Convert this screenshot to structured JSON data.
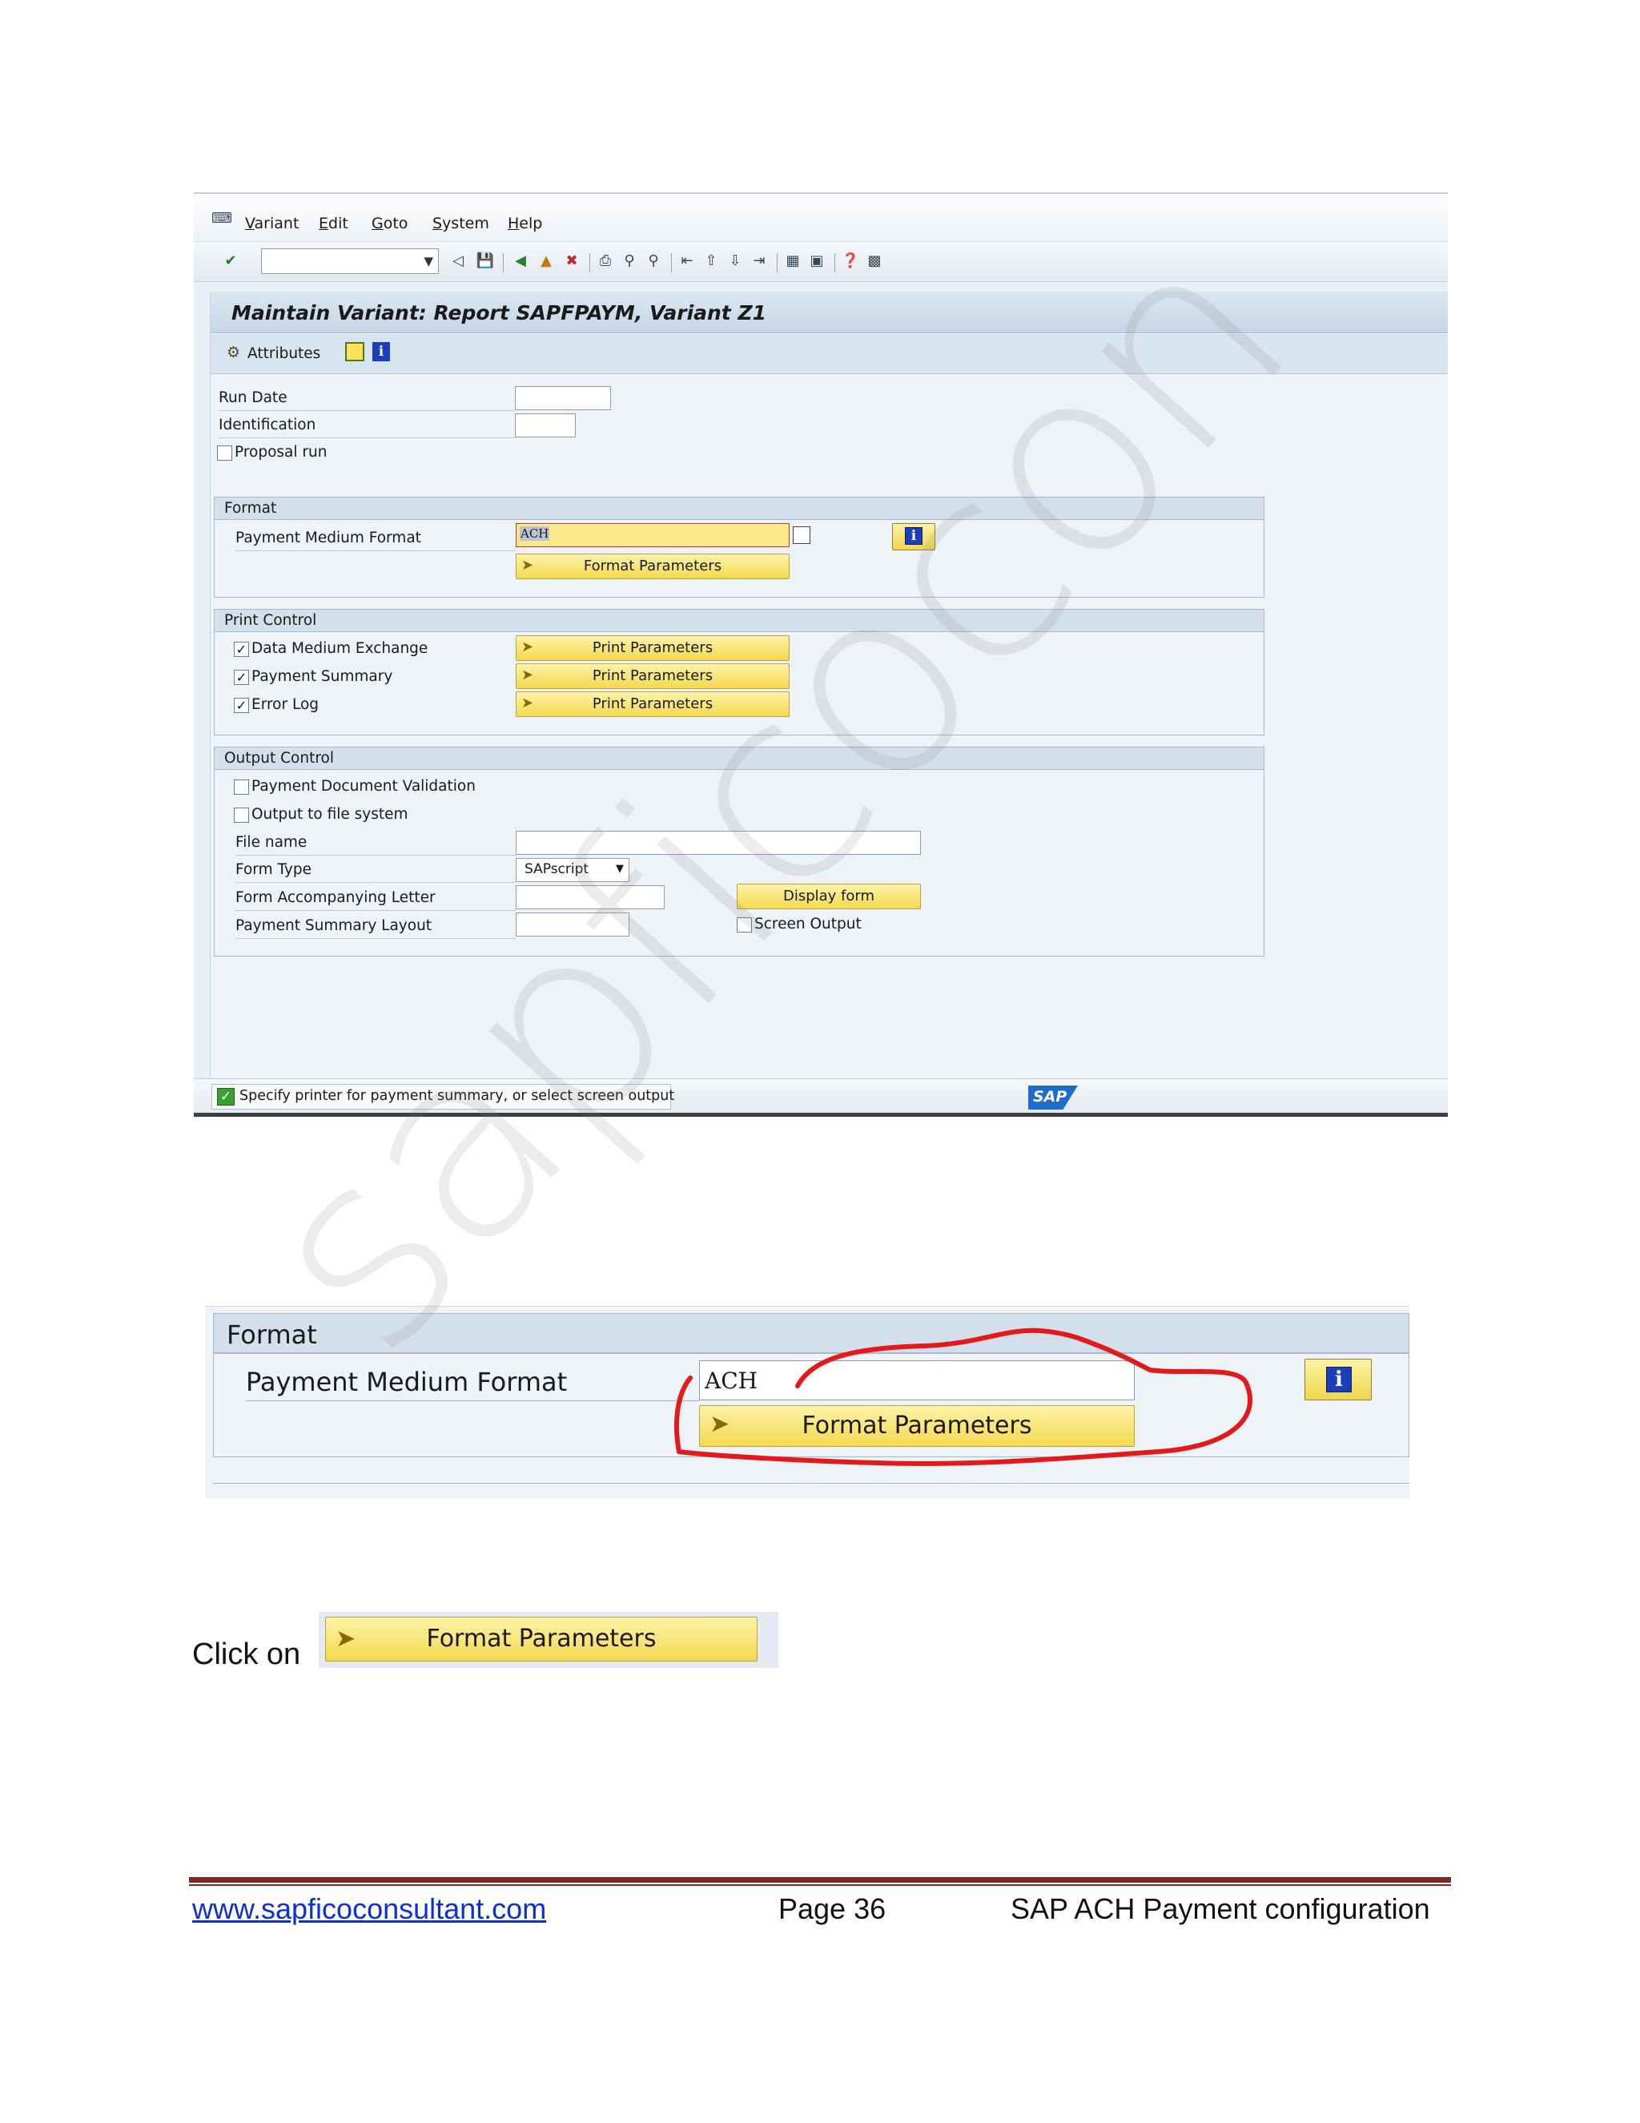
{
  "watermark": "sapficocon",
  "screen": {
    "menu": [
      "Variant",
      "Edit",
      "Goto",
      "System",
      "Help"
    ],
    "title": "Maintain Variant: Report SAPFPAYM, Variant Z1",
    "app_toolbar": {
      "attributes_label": "Attributes"
    },
    "fields": {
      "run_date": {
        "label": "Run Date",
        "value": ""
      },
      "identification": {
        "label": "Identification",
        "value": ""
      },
      "proposal_run": {
        "label": "Proposal run",
        "checked": false
      }
    },
    "format_group": {
      "title": "Format",
      "payment_medium_format_label": "Payment Medium Format",
      "payment_medium_format_value": "ACH",
      "format_parameters_button": "Format Parameters"
    },
    "print_control": {
      "title": "Print Control",
      "rows": [
        {
          "label": "Data Medium Exchange",
          "checked": true,
          "button": "Print Parameters"
        },
        {
          "label": "Payment Summary",
          "checked": true,
          "button": "Print Parameters"
        },
        {
          "label": "Error Log",
          "checked": true,
          "button": "Print Parameters"
        }
      ]
    },
    "output_control": {
      "title": "Output Control",
      "payment_document_validation": "Payment Document Validation",
      "output_to_file_system": "Output to file system",
      "file_name_label": "File name",
      "form_type_label": "Form Type",
      "form_type_value": "SAPscript",
      "form_accompanying_letter_label": "Form Accompanying Letter",
      "display_form_button": "Display form",
      "payment_summary_layout_label": "Payment Summary Layout",
      "screen_output_label": "Screen Output"
    },
    "status_message": "Specify printer for payment summary, or select screen output",
    "sap_logo": "SAP"
  },
  "zoom": {
    "group_title": "Format",
    "field_label": "Payment Medium Format",
    "field_value": "ACH",
    "button_label": "Format Parameters"
  },
  "instruction": {
    "text": "Click on",
    "button_label": "Format Parameters"
  },
  "footer": {
    "website": "www.sapficoconsultant.com",
    "page": "Page 36",
    "doc_title": "SAP ACH Payment configuration"
  },
  "colors": {
    "button_yellow": "#f4d94f",
    "highlight_red": "#e3191b",
    "footer_rule": "#7b2b27",
    "link_blue": "#0b2fd8"
  }
}
